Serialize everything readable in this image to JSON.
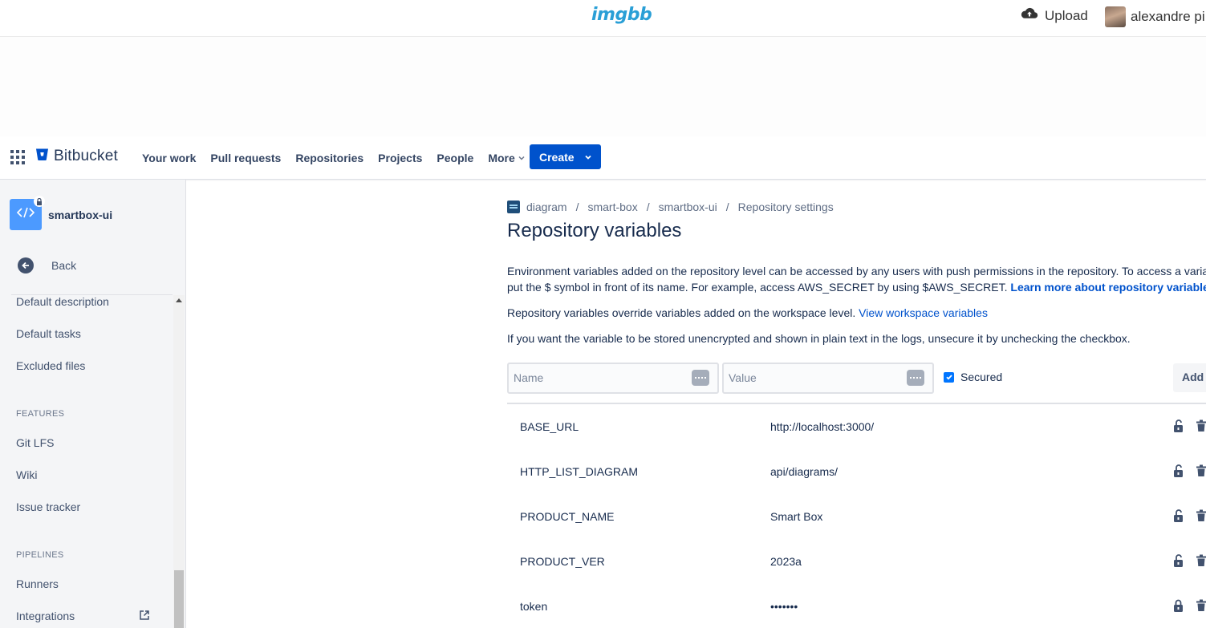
{
  "imgbb": {
    "logo": "imgbb",
    "upload_label": "Upload",
    "user_name": "alexandre pi"
  },
  "nav": {
    "brand": "Bitbucket",
    "items": [
      "Your work",
      "Pull requests",
      "Repositories",
      "Projects",
      "People"
    ],
    "more_label": "More",
    "create_label": "Create"
  },
  "sidebar": {
    "repo_name": "smartbox-ui",
    "back_label": "Back",
    "items_top": [
      "Default description",
      "Default tasks",
      "Excluded files"
    ],
    "features_heading": "FEATURES",
    "features_items": [
      "Git LFS",
      "Wiki",
      "Issue tracker"
    ],
    "pipelines_heading": "PIPELINES",
    "pipelines_items": [
      "Runners",
      "Integrations"
    ]
  },
  "main": {
    "breadcrumb": [
      "diagram",
      "smart-box",
      "smartbox-ui",
      "Repository settings"
    ],
    "title": "Repository variables",
    "intro_line1": "Environment variables added on the repository level can be accessed by any users with push permissions in the repository. To access a variable,",
    "intro_line2": "put the $ symbol in front of its name. For example, access AWS_SECRET by using $AWS_SECRET.",
    "intro_link": "Learn more about repository variables",
    "intro_end": ".",
    "override_text": "Repository variables override variables added on the workspace level.",
    "override_link": "View workspace variables",
    "unencrypted_text": "If you want the variable to be stored unencrypted and shown in plain text in the logs, unsecure it by unchecking the checkbox.",
    "name_placeholder": "Name",
    "value_placeholder": "Value",
    "secured_label": "Secured",
    "secured_checked": true,
    "add_label": "Add"
  },
  "variables": [
    {
      "name": "BASE_URL",
      "value": "http://localhost:3000/",
      "secured": false
    },
    {
      "name": "HTTP_LIST_DIAGRAM",
      "value": "api/diagrams/",
      "secured": false
    },
    {
      "name": "PRODUCT_NAME",
      "value": "Smart Box",
      "secured": false
    },
    {
      "name": "PRODUCT_VER",
      "value": "2023a",
      "secured": false
    },
    {
      "name": "token",
      "value": "•••••••",
      "secured": true
    }
  ],
  "colors": {
    "primary": "#0052cc",
    "imgbb_blue": "#2a9fd6",
    "sidebar_bg": "#f4f5f7",
    "text": "#172b4d"
  }
}
